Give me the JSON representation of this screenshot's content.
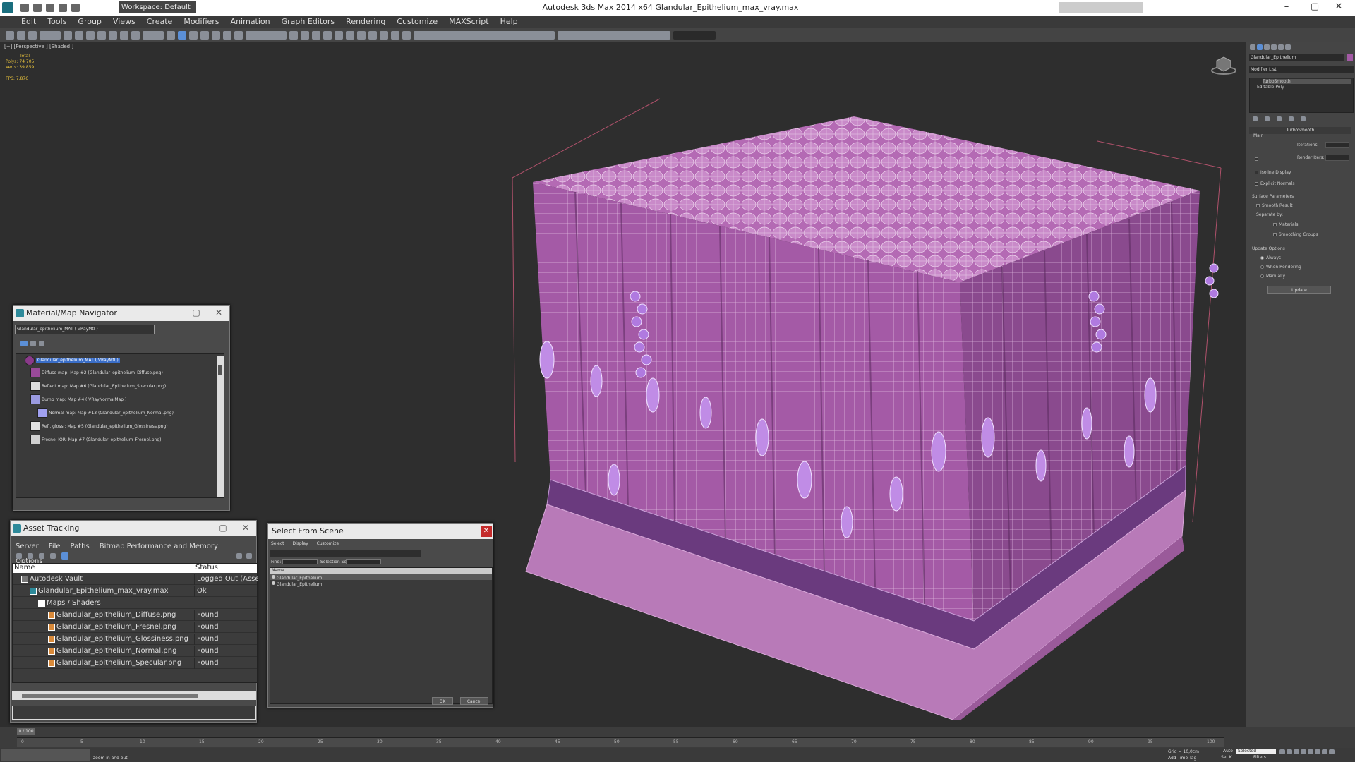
{
  "app": {
    "title": "Autodesk 3ds Max  2014 x64     Glandular_Epithelium_max_vray.max",
    "workspace": "Workspace: Default"
  },
  "menu": [
    "Edit",
    "Tools",
    "Group",
    "Views",
    "Create",
    "Modifiers",
    "Animation",
    "Graph Editors",
    "Rendering",
    "Customize",
    "MAXScript",
    "Help"
  ],
  "viewport": {
    "label": "[+] [Perspective ] [Shaded ]",
    "stats": {
      "total_label": "Total",
      "polys_label": "Polys:",
      "polys_value": "74 705",
      "verts_label": "Verts:",
      "verts_value": "39 859",
      "fps_label": "FPS:",
      "fps_value": "7.876"
    }
  },
  "command_panel": {
    "object_name": "Glandular_Epithelium",
    "modifier_list": "Modifier List",
    "stack": [
      "TurboSmooth",
      "Editable Poly"
    ],
    "turbosmooth": {
      "header": "TurboSmooth",
      "main": "Main",
      "iterations_label": "Iterations:",
      "render_iters_label": "Render Iters:",
      "isoline": "Isoline Display",
      "explicit": "Explicit Normals",
      "surface_params": "Surface Parameters",
      "smooth_result": "Smooth Result",
      "separate_by": "Separate by:",
      "materials": "Materials",
      "smoothing_groups": "Smoothing Groups",
      "update_options": "Update Options",
      "always": "Always",
      "when_rendering": "When Rendering",
      "manually": "Manually",
      "update_btn": "Update"
    }
  },
  "material_navigator": {
    "title": "Material/Map Navigator",
    "field": "Glandular_epithelium_MAT  ( VRayMtl )",
    "items": [
      {
        "label": "Glandular_epithelium_MAT  ( VRayMtl )",
        "color": "#8a3a8a"
      },
      {
        "label": "Diffuse map: Map #2 (Glandular_epithelium_Diffuse.png)",
        "color": "#9a4a9a"
      },
      {
        "label": "Reflect map: Map #6 (Glandular_Epithelium_Specular.png)",
        "color": "#dcdcdc"
      },
      {
        "label": "Bump map: Map #4  ( VRayNormalMap )",
        "color": "#9a9ae0"
      },
      {
        "label": "Normal map: Map #13 (Glandular_epithelium_Normal.png)",
        "color": "#a0a0f0"
      },
      {
        "label": "Refl. gloss.: Map #5 (Glandular_epithelium_Glossiness.png)",
        "color": "#e0e0e0"
      },
      {
        "label": "Fresnel IOR: Map #7 (Glandular_epithelium_Fresnel.png)",
        "color": "#d0d0d0"
      }
    ]
  },
  "asset_tracking": {
    "title": "Asset Tracking",
    "menu": [
      "Server",
      "File",
      "Paths",
      "Bitmap Performance and Memory",
      "Options"
    ],
    "col_name": "Name",
    "col_status": "Status",
    "rows": [
      {
        "name": "Autodesk Vault",
        "status": "Logged Out (Asset Tr"
      },
      {
        "name": "Glandular_Epithelium_max_vray.max",
        "status": "Ok"
      },
      {
        "name": "Maps / Shaders",
        "status": ""
      },
      {
        "name": "Glandular_epithelium_Diffuse.png",
        "status": "Found"
      },
      {
        "name": "Glandular_epithelium_Fresnel.png",
        "status": "Found"
      },
      {
        "name": "Glandular_epithelium_Glossiness.png",
        "status": "Found"
      },
      {
        "name": "Glandular_epithelium_Normal.png",
        "status": "Found"
      },
      {
        "name": "Glandular_Epithelium_Specular.png",
        "status": "Found"
      }
    ]
  },
  "select_from_scene": {
    "title": "Select From Scene",
    "menu": [
      "Select",
      "Display",
      "Customize"
    ],
    "find_label": "Find:",
    "selection_set": "Selection Set:",
    "col_name": "Name",
    "items": [
      "Glandular_Epithelium",
      "Glandular_Epithelium"
    ],
    "ok": "OK",
    "cancel": "Cancel"
  },
  "timeline": {
    "frame": "0 / 100",
    "ticks": [
      "0",
      "5",
      "10",
      "15",
      "20",
      "25",
      "30",
      "35",
      "40",
      "45",
      "50",
      "55",
      "60",
      "65",
      "70",
      "75",
      "80",
      "85",
      "90",
      "95",
      "100"
    ]
  },
  "status": {
    "prompt": "zoom in and out",
    "grid": "Grid = 10,0cm",
    "add_time_tag": "Add Time Tag",
    "auto": "Auto",
    "selected": "Selected",
    "set_k": "Set K.",
    "filters": "Filters..."
  },
  "colors": {
    "mesh_fill": "#a85aa8",
    "mesh_wire": "#e7c7e7",
    "base": "#b06ab0"
  }
}
